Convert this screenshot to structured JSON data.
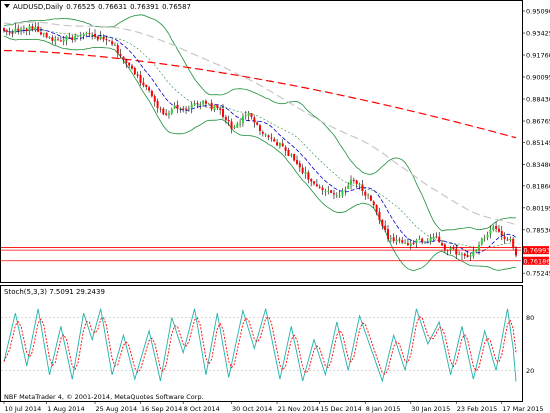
{
  "chart_data": [
    {
      "type": "candlestick",
      "title": "AUDUSD,Daily",
      "ohlc_header": [
        "0.76525",
        "0.76631",
        "0.76391",
        "0.76587"
      ],
      "ylim": [
        0.7458,
        0.9585
      ],
      "y_ticks": [
        "0.95090",
        "0.93425",
        "0.91760",
        "0.90095",
        "0.88430",
        "0.86765",
        "0.85145",
        "0.83480",
        "0.81860",
        "0.80195",
        "0.78530",
        "0.75245"
      ],
      "price_labels": [
        {
          "value": 0.76993,
          "text": "0.76993",
          "color": "#ff0000"
        },
        {
          "value": 0.76186,
          "text": "0.76186",
          "color": "#ff0000"
        }
      ],
      "horizontal_lines": [
        0.77195,
        0.76993,
        0.76186
      ],
      "x_ticks": [
        {
          "i": 0,
          "label": "10 Jul 2014"
        },
        {
          "i": 15,
          "label": "1 Aug 2014"
        },
        {
          "i": 32,
          "label": "25 Aug 2014"
        },
        {
          "i": 48,
          "label": "16 Sep 2014"
        },
        {
          "i": 63,
          "label": "8 Oct 2014"
        },
        {
          "i": 80,
          "label": "30 Oct 2014"
        },
        {
          "i": 96,
          "label": "21 Nov 2014"
        },
        {
          "i": 111,
          "label": "15 Dec 2014"
        },
        {
          "i": 127,
          "label": "8 Jan 2015"
        },
        {
          "i": 143,
          "label": "30 Jan 2015"
        },
        {
          "i": 159,
          "label": "23 Feb 2015"
        },
        {
          "i": 175,
          "label": "17 Mar 2015"
        }
      ],
      "key_closes": [
        {
          "i": 0,
          "v": 0.935
        },
        {
          "i": 10,
          "v": 0.938
        },
        {
          "i": 18,
          "v": 0.9285
        },
        {
          "i": 30,
          "v": 0.933
        },
        {
          "i": 38,
          "v": 0.9265
        },
        {
          "i": 45,
          "v": 0.906
        },
        {
          "i": 52,
          "v": 0.888
        },
        {
          "i": 56,
          "v": 0.871
        },
        {
          "i": 60,
          "v": 0.879
        },
        {
          "i": 64,
          "v": 0.8775
        },
        {
          "i": 70,
          "v": 0.881
        },
        {
          "i": 76,
          "v": 0.876
        },
        {
          "i": 80,
          "v": 0.862
        },
        {
          "i": 86,
          "v": 0.873
        },
        {
          "i": 92,
          "v": 0.8555
        },
        {
          "i": 98,
          "v": 0.848
        },
        {
          "i": 104,
          "v": 0.833
        },
        {
          "i": 110,
          "v": 0.817
        },
        {
          "i": 114,
          "v": 0.813
        },
        {
          "i": 118,
          "v": 0.812
        },
        {
          "i": 122,
          "v": 0.823
        },
        {
          "i": 125,
          "v": 0.818
        },
        {
          "i": 130,
          "v": 0.8055
        },
        {
          "i": 133,
          "v": 0.787
        },
        {
          "i": 136,
          "v": 0.777
        },
        {
          "i": 142,
          "v": 0.775
        },
        {
          "i": 148,
          "v": 0.778
        },
        {
          "i": 152,
          "v": 0.7795
        },
        {
          "i": 155,
          "v": 0.772
        },
        {
          "i": 160,
          "v": 0.767
        },
        {
          "i": 164,
          "v": 0.7645
        },
        {
          "i": 168,
          "v": 0.7775
        },
        {
          "i": 172,
          "v": 0.787
        },
        {
          "i": 176,
          "v": 0.779
        },
        {
          "i": 178,
          "v": 0.7765
        },
        {
          "i": 180,
          "v": 0.76587
        }
      ],
      "colors": {
        "bull": "#32cd32",
        "bear": "#ff0000",
        "wick": "#000000",
        "bands": "#1f8f3a",
        "fast_ma": "#0000cd",
        "slow_ma": "#c8c8c8",
        "long_ma": "#ff0000",
        "level": "#ff0000"
      }
    },
    {
      "type": "line",
      "title": "Stoch(5,3,3) 7.5091 29.2439",
      "ylim": [
        0,
        100
      ],
      "levels": [
        20,
        80
      ],
      "y_ticks": [
        "80",
        "20"
      ],
      "series": [
        {
          "color": "#20b2aa",
          "dash": false
        },
        {
          "color": "#ff0000",
          "dash": true
        }
      ],
      "stoch_peaks": [
        {
          "i": 0,
          "v": 30
        },
        {
          "i": 4,
          "v": 85
        },
        {
          "i": 8,
          "v": 25
        },
        {
          "i": 12,
          "v": 90
        },
        {
          "i": 16,
          "v": 15
        },
        {
          "i": 20,
          "v": 70
        },
        {
          "i": 24,
          "v": 10
        },
        {
          "i": 28,
          "v": 85
        },
        {
          "i": 31,
          "v": 55
        },
        {
          "i": 34,
          "v": 90
        },
        {
          "i": 38,
          "v": 15
        },
        {
          "i": 42,
          "v": 60
        },
        {
          "i": 46,
          "v": 10
        },
        {
          "i": 51,
          "v": 65
        },
        {
          "i": 55,
          "v": 8
        },
        {
          "i": 59,
          "v": 80
        },
        {
          "i": 63,
          "v": 40
        },
        {
          "i": 67,
          "v": 90
        },
        {
          "i": 71,
          "v": 15
        },
        {
          "i": 75,
          "v": 85
        },
        {
          "i": 79,
          "v": 12
        },
        {
          "i": 84,
          "v": 88
        },
        {
          "i": 88,
          "v": 45
        },
        {
          "i": 92,
          "v": 90
        },
        {
          "i": 97,
          "v": 10
        },
        {
          "i": 101,
          "v": 70
        },
        {
          "i": 105,
          "v": 8
        },
        {
          "i": 109,
          "v": 55
        },
        {
          "i": 113,
          "v": 15
        },
        {
          "i": 117,
          "v": 75
        },
        {
          "i": 121,
          "v": 20
        },
        {
          "i": 125,
          "v": 82
        },
        {
          "i": 129,
          "v": 45
        },
        {
          "i": 133,
          "v": 8
        },
        {
          "i": 137,
          "v": 60
        },
        {
          "i": 141,
          "v": 20
        },
        {
          "i": 145,
          "v": 90
        },
        {
          "i": 149,
          "v": 50
        },
        {
          "i": 153,
          "v": 75
        },
        {
          "i": 157,
          "v": 15
        },
        {
          "i": 161,
          "v": 70
        },
        {
          "i": 165,
          "v": 10
        },
        {
          "i": 169,
          "v": 65
        },
        {
          "i": 173,
          "v": 20
        },
        {
          "i": 177,
          "v": 90
        },
        {
          "i": 179,
          "v": 45
        },
        {
          "i": 180,
          "v": 7.5
        }
      ]
    }
  ],
  "footer": {
    "copyright": "NBF MetaTrader 4, © 2001-2014, MetaQuotes Software Corp."
  }
}
